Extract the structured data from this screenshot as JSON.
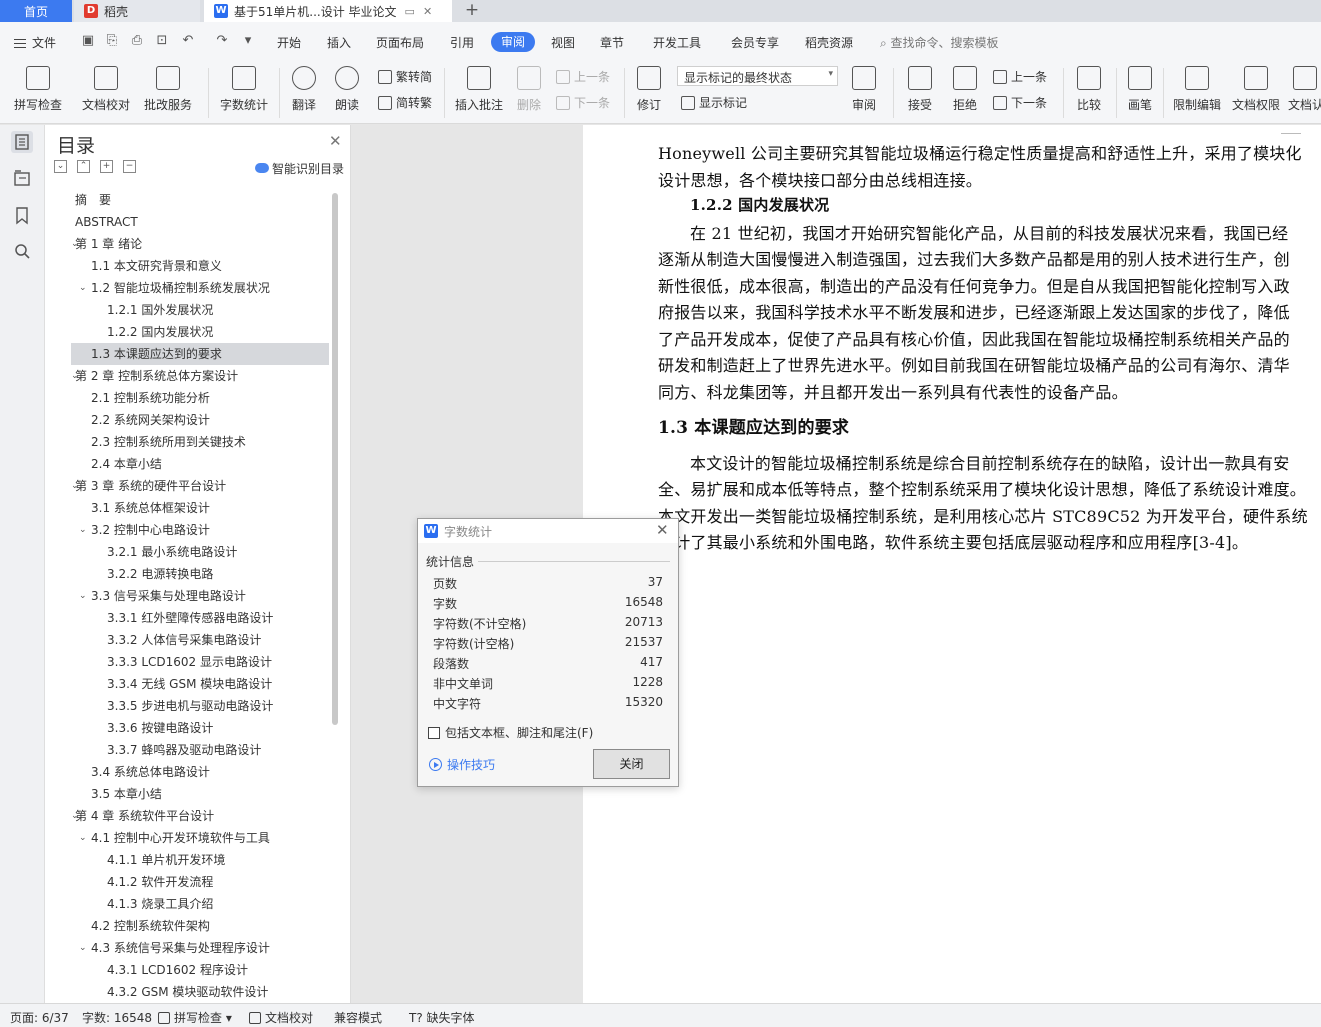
{
  "tabs": {
    "home": "首页",
    "daoke": "稻壳",
    "document": "基于51单片机...设计 毕业论文"
  },
  "menu": {
    "file": "文件",
    "items": [
      "开始",
      "插入",
      "页面布局",
      "引用",
      "审阅",
      "视图",
      "章节",
      "开发工具",
      "会员专享",
      "稻壳资源"
    ],
    "active": "审阅",
    "search_placeholder": "查找命令、搜索模板"
  },
  "ribbon": {
    "spell_check": "拼写检查",
    "doc_proof": "文档校对",
    "batch_service": "批改服务",
    "word_count": "字数统计",
    "translate": "翻译",
    "read_aloud": "朗读",
    "to_traditional": "繁转简",
    "to_simplified": "简转繁",
    "insert_comment": "插入批注",
    "delete": "删除",
    "prev_comment": "上一条",
    "next_comment": "下一条",
    "track_changes": "修订",
    "markup_state": "显示标记的最终状态",
    "show_markup": "显示标记",
    "review": "审阅",
    "accept": "接受",
    "reject": "拒绝",
    "prev_change": "上一条",
    "next_change": "下一条",
    "compare": "比较",
    "pen": "画笔",
    "restrict_edit": "限制编辑",
    "doc_permission": "文档权限",
    "doc_cut": "文档认"
  },
  "toc": {
    "title": "目录",
    "smart_label": "智能识别目录",
    "items": [
      {
        "label": "摘　要",
        "level": 0
      },
      {
        "label": "ABSTRACT",
        "level": 0
      },
      {
        "label": "第 1 章  绪论",
        "level": 1
      },
      {
        "label": "1.1  本文研究背景和意义",
        "level": 2
      },
      {
        "label": "1.2  智能垃圾桶控制系统发展状况",
        "level": 3
      },
      {
        "label": "1.2.1  国外发展状况",
        "level": 4
      },
      {
        "label": "1.2.2  国内发展状况",
        "level": 4
      },
      {
        "label": "1.3  本课题应达到的要求",
        "level": 2
      },
      {
        "label": "第 2 章  控制系统总体方案设计",
        "level": 1
      },
      {
        "label": "2.1  控制系统功能分析",
        "level": 2
      },
      {
        "label": "2.2  系统网关架构设计",
        "level": 2
      },
      {
        "label": "2.3  控制系统所用到关键技术",
        "level": 2
      },
      {
        "label": "2.4  本章小结",
        "level": 2
      },
      {
        "label": "第 3 章  系统的硬件平台设计",
        "level": 1
      },
      {
        "label": "3.1  系统总体框架设计",
        "level": 2
      },
      {
        "label": "3.2  控制中心电路设计",
        "level": 3
      },
      {
        "label": "3.2.1  最小系统电路设计",
        "level": 4
      },
      {
        "label": "3.2.2  电源转换电路",
        "level": 4
      },
      {
        "label": "3.3  信号采集与处理电路设计",
        "level": 3
      },
      {
        "label": "3.3.1  红外壁障传感器电路设计",
        "level": 4
      },
      {
        "label": "3.3.2  人体信号采集电路设计",
        "level": 4
      },
      {
        "label": "3.3.3 LCD1602 显示电路设计",
        "level": 4
      },
      {
        "label": "3.3.4  无线 GSM 模块电路设计",
        "level": 4
      },
      {
        "label": "3.3.5  步进电机与驱动电路设计",
        "level": 4
      },
      {
        "label": "3.3.6  按键电路设计",
        "level": 4
      },
      {
        "label": "3.3.7  蜂鸣器及驱动电路设计",
        "level": 4
      },
      {
        "label": "3.4  系统总体电路设计",
        "level": 2
      },
      {
        "label": "3.5  本章小结",
        "level": 2
      },
      {
        "label": "第 4 章  系统软件平台设计",
        "level": 1
      },
      {
        "label": "4.1  控制中心开发环境软件与工具",
        "level": 3
      },
      {
        "label": "4.1.1  单片机开发环境",
        "level": 4
      },
      {
        "label": "4.1.2  软件开发流程",
        "level": 4
      },
      {
        "label": "4.1.3  烧录工具介绍",
        "level": 4
      },
      {
        "label": "4.2  控制系统软件架构",
        "level": 2
      },
      {
        "label": "4.3  系统信号采集与处理程序设计",
        "level": 3
      },
      {
        "label": "4.3.1 LCD1602 程序设计",
        "level": 4
      },
      {
        "label": "4.3.2 GSM 模块驱动软件设计",
        "level": 4
      }
    ],
    "selected_label": "1.3  本课题应达到的要求"
  },
  "document": {
    "lines": [
      {
        "text": "Honeywell 公司主要研究其智能垃圾桶运行稳定性质量提高和舒适性上升，采用了模块化",
        "style": "body"
      },
      {
        "text": "设计思想，各个模块接口部分由总线相连接。",
        "style": "body"
      },
      {
        "text": "1.2.2  国内发展状况",
        "style": "h2"
      },
      {
        "text": "在 21 世纪初，我国才开始研究智能化产品，从目前的科技发展状况来看，我国已经",
        "style": "first"
      },
      {
        "text": "逐渐从制造大国慢慢进入制造强国，过去我们大多数产品都是用的别人技术进行生产，创",
        "style": "body"
      },
      {
        "text": "新性很低，成本很高，制造出的产品没有任何竞争力。但是自从我国把智能化控制写入政",
        "style": "body"
      },
      {
        "text": "府报告以来，我国科学技术水平不断发展和进步，已经逐渐跟上发达国家的步伐了，降低",
        "style": "body"
      },
      {
        "text": "了产品开发成本，促使了产品具有核心价值，因此我国在智能垃圾桶控制系统相关产品的",
        "style": "body"
      },
      {
        "text": "研发和制造赶上了世界先进水平。例如目前我国在研智能垃圾桶产品的公司有海尔、清华",
        "style": "body"
      },
      {
        "text": "同方、科龙集团等，并且都开发出一系列具有代表性的设备产品。",
        "style": "body"
      },
      {
        "text": "1.3  本课题应达到的要求",
        "style": "h1"
      },
      {
        "text": "本文设计的智能垃圾桶控制系统是综合目前控制系统存在的缺陷，设计出一款具有安",
        "style": "first"
      },
      {
        "text": "全、易扩展和成本低等特点，整个控制系统采用了模块化设计思想，降低了系统设计难度。",
        "style": "body"
      },
      {
        "text": "本文开发出一类智能垃圾桶控制系统，是利用核心芯片 STC89C52 为开发平台，硬件系统",
        "style": "body"
      },
      {
        "text": "设计了其最小系统和外围电路，软件系统主要包括底层驱动程序和应用程序[3-4]。",
        "style": "body"
      }
    ]
  },
  "wordcount_dialog": {
    "title": "字数统计",
    "group_label": "统计信息",
    "rows": [
      {
        "key": "页数",
        "value": "37"
      },
      {
        "key": "字数",
        "value": "16548"
      },
      {
        "key": "字符数(不计空格)",
        "value": "20713"
      },
      {
        "key": "字符数(计空格)",
        "value": "21537"
      },
      {
        "key": "段落数",
        "value": "417"
      },
      {
        "key": "非中文单词",
        "value": "1228"
      },
      {
        "key": "中文字符",
        "value": "15320"
      }
    ],
    "include_label": "包括文本框、脚注和尾注(F)",
    "tips_label": "操作技巧",
    "close_label": "关闭"
  },
  "statusbar": {
    "page": "页面: 6/37",
    "words": "字数: 16548",
    "spell_check": "拼写检查",
    "doc_proof": "文档校对",
    "compat_mode": "兼容模式",
    "missing_fonts": "缺失字体"
  }
}
